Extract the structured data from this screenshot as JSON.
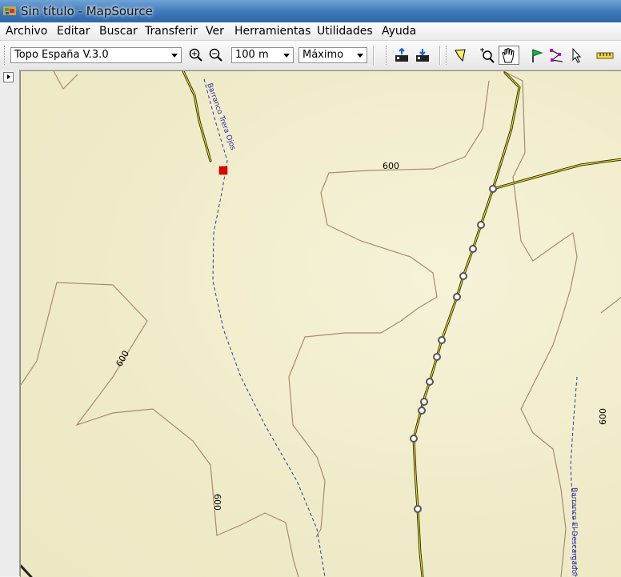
{
  "window": {
    "title": "Sin título - MapSource"
  },
  "menu": [
    "Archivo",
    "Editar",
    "Buscar",
    "Transferir",
    "Ver",
    "Herramientas",
    "Utilidades",
    "Ayuda"
  ],
  "toolbar": {
    "map_product": "Topo España V.3.0",
    "zoom_scale": "100 m",
    "detail_level": "Máximo",
    "icons": [
      "zoom-in-icon",
      "zoom-out-icon",
      "send-to-device-icon",
      "receive-from-device-icon",
      "select-icon",
      "zoom-tool-icon",
      "hand-tool-icon",
      "waypoint-flag-icon",
      "route-tool-icon",
      "pointer-icon",
      "measure-icon"
    ]
  },
  "map": {
    "contour_labels": [
      "600",
      "600",
      "600",
      "600"
    ],
    "river_labels": [
      "Barranco Trera Ojos",
      "Barranco El Descargador"
    ],
    "colors": {
      "background": "#efebc8",
      "contour": "#a88a6e",
      "road_fill": "#f2e600",
      "river": "#2a3aa0",
      "marker": "#e00000"
    }
  }
}
